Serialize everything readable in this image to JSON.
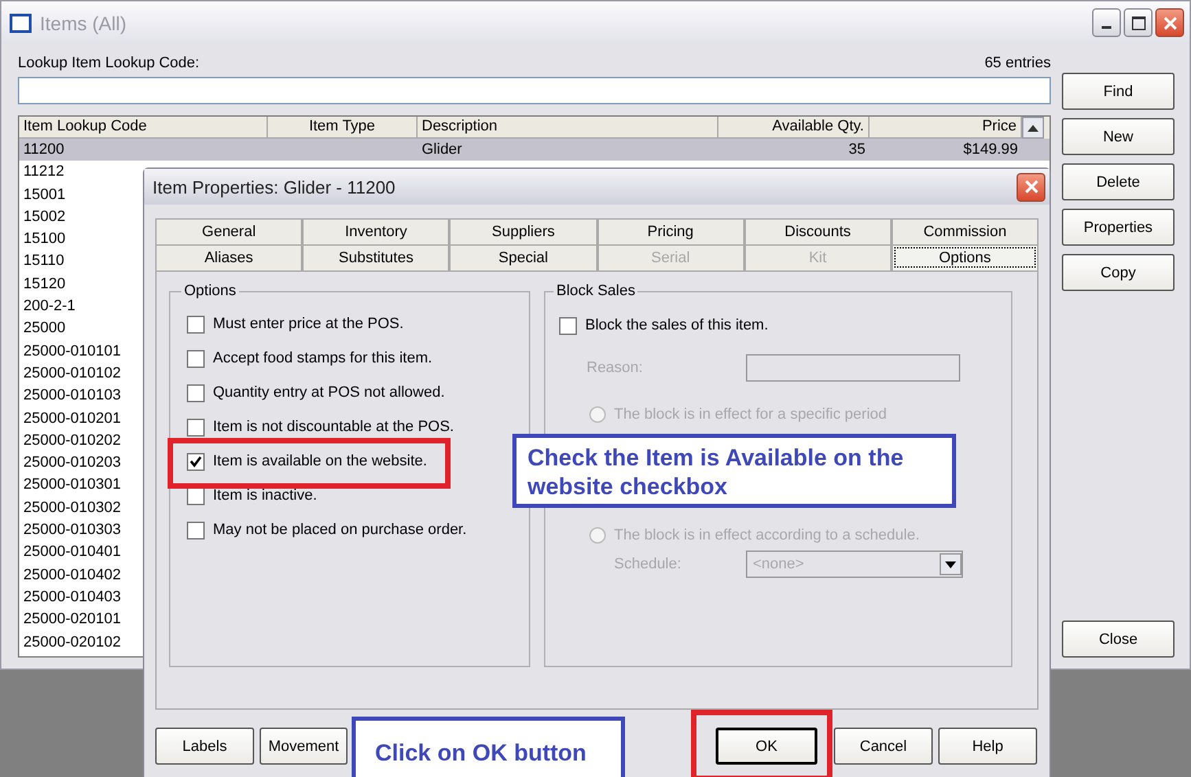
{
  "main_window": {
    "title": "Items (All)",
    "lookup_label": "Lookup Item Lookup Code:",
    "entries": "65 entries",
    "columns": [
      "Item Lookup Code",
      "Item Type",
      "Description",
      "Available Qty.",
      "Price"
    ],
    "rows": [
      {
        "code": "11200",
        "description": "Glider",
        "qty": "35",
        "price": "$149.99",
        "selected": true
      },
      {
        "code": "11212",
        "selected": false
      },
      {
        "code": "15001",
        "selected": false
      },
      {
        "code": "15002",
        "selected": false
      },
      {
        "code": "15100",
        "selected": false
      },
      {
        "code": "15110",
        "selected": false
      },
      {
        "code": "15120",
        "selected": false
      },
      {
        "code": "200-2-1",
        "selected": false
      },
      {
        "code": "25000",
        "selected": false
      },
      {
        "code": "25000-010101",
        "selected": false
      },
      {
        "code": "25000-010102",
        "selected": false
      },
      {
        "code": "25000-010103",
        "selected": false
      },
      {
        "code": "25000-010201",
        "selected": false
      },
      {
        "code": "25000-010202",
        "selected": false
      },
      {
        "code": "25000-010203",
        "selected": false
      },
      {
        "code": "25000-010301",
        "selected": false
      },
      {
        "code": "25000-010302",
        "selected": false
      },
      {
        "code": "25000-010303",
        "selected": false
      },
      {
        "code": "25000-010401",
        "selected": false
      },
      {
        "code": "25000-010402",
        "selected": false
      },
      {
        "code": "25000-010403",
        "selected": false
      },
      {
        "code": "25000-020101",
        "selected": false
      },
      {
        "code": "25000-020102",
        "selected": false
      }
    ],
    "buttons": [
      "Find",
      "New",
      "Delete",
      "Properties",
      "Copy"
    ],
    "close_button": "Close"
  },
  "dialog": {
    "title": "Item Properties: Glider - 11200",
    "tab_rows": [
      [
        {
          "label": "General",
          "selected": false,
          "disabled": false
        },
        {
          "label": "Inventory",
          "selected": false,
          "disabled": false
        },
        {
          "label": "Suppliers",
          "selected": false,
          "disabled": false
        },
        {
          "label": "Pricing",
          "selected": false,
          "disabled": false
        },
        {
          "label": "Discounts",
          "selected": false,
          "disabled": false
        },
        {
          "label": "Commission",
          "selected": false,
          "disabled": false
        }
      ],
      [
        {
          "label": "Aliases",
          "selected": false,
          "disabled": false
        },
        {
          "label": "Substitutes",
          "selected": false,
          "disabled": false
        },
        {
          "label": "Special",
          "selected": false,
          "disabled": false
        },
        {
          "label": "Serial",
          "selected": false,
          "disabled": true
        },
        {
          "label": "Kit",
          "selected": false,
          "disabled": true
        },
        {
          "label": "Options",
          "selected": true,
          "disabled": false
        }
      ]
    ],
    "options": {
      "title": "Options",
      "items": [
        {
          "label": "Must enter price at the POS.",
          "checked": false
        },
        {
          "label": "Accept food stamps for this item.",
          "checked": false
        },
        {
          "label": "Quantity entry at POS not allowed.",
          "checked": false
        },
        {
          "label": "Item is not discountable at the POS.",
          "checked": false
        },
        {
          "label": "Item is available on the website.",
          "checked": true
        },
        {
          "label": "Item is inactive.",
          "checked": false
        },
        {
          "label": "May not be placed on purchase order.",
          "checked": false
        }
      ]
    },
    "block_sales": {
      "title": "Block Sales",
      "checkbox": {
        "label": "Block the sales of this item.",
        "checked": false
      },
      "disabled": true,
      "reason_label": "Reason:",
      "radios": [
        {
          "label": "The block is in effect for a specific period",
          "selected": false
        },
        {
          "label": "The block is in effect according to a schedule.",
          "selected": false
        }
      ],
      "schedule_label": "Schedule:",
      "schedule_value": "<none>"
    },
    "left_buttons": [
      "Labels",
      "Movement"
    ],
    "right_buttons": [
      {
        "label": "OK",
        "default": true
      },
      {
        "label": "Cancel",
        "default": false
      },
      {
        "label": "Help",
        "default": false
      }
    ]
  },
  "callouts": [
    {
      "text": "Check the Item is Available on the website checkbox"
    },
    {
      "text": "Click on OK button"
    }
  ]
}
